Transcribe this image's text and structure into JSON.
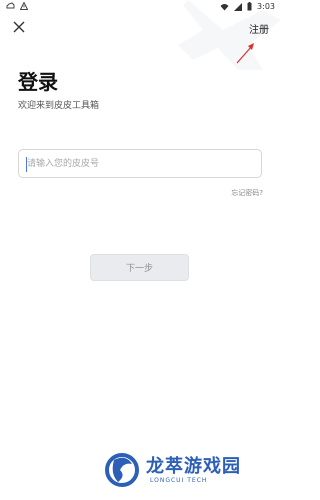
{
  "status_bar": {
    "time": "3:03"
  },
  "header": {
    "register_label": "注册"
  },
  "login": {
    "title": "登录",
    "subtitle": "欢迎来到皮皮工具箱",
    "input_placeholder": "请输入您的皮皮号",
    "forgot_label": "忘记密码?",
    "next_label": "下一步"
  },
  "watermark": {
    "cn": "龙萃游戏园",
    "en": "LONGCUI TECH"
  },
  "colors": {
    "accent": "#4a7bd8",
    "arrow": "#d9322b",
    "brand": "#2d5fb8",
    "button_bg": "#e9ebee"
  }
}
